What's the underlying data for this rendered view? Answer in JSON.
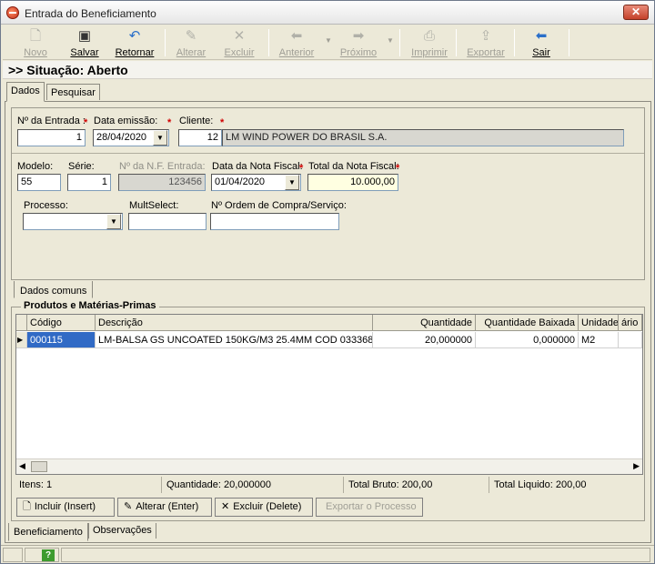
{
  "window": {
    "title": "Entrada do Beneficiamento"
  },
  "toolbar": {
    "novo": "Novo",
    "salvar": "Salvar",
    "retornar": "Retornar",
    "alterar": "Alterar",
    "excluir": "Excluir",
    "anterior": "Anterior",
    "proximo": "Próximo",
    "imprimir": "Imprimir",
    "exportar": "Exportar",
    "sair": "Sair"
  },
  "situation": ">> Situação: Aberto",
  "tabs": {
    "dados": "Dados",
    "pesquisar": "Pesquisar"
  },
  "form": {
    "n_entrada_label": "Nº da Entrada :",
    "n_entrada_value": "1",
    "data_emissao_label": "Data emissão:",
    "data_emissao_value": "28/04/2020",
    "cliente_label": "Cliente:",
    "cliente_code": "12",
    "cliente_name": "LM WIND POWER DO BRASIL S.A.",
    "modelo_label": "Modelo:",
    "modelo_value": "55",
    "serie_label": "Série:",
    "serie_value": "1",
    "nf_entrada_label": "Nº da N.F. Entrada:",
    "nf_entrada_value": "123456",
    "data_nf_label": "Data da Nota Fiscal:",
    "data_nf_value": "01/04/2020",
    "total_nf_label": "Total da Nota Fiscal:",
    "total_nf_value": "10.000,00",
    "processo_label": "Processo:",
    "processo_value": "",
    "multiselect_label": "MultSelect:",
    "multiselect_value": "",
    "ordem_label": "Nº Ordem de Compra/Serviço:",
    "ordem_value": ""
  },
  "subtab": {
    "dados_comuns": "Dados comuns"
  },
  "products": {
    "group_title": "Produtos e Matérias-Primas",
    "columns": [
      "Código",
      "Descrição",
      "Quantidade",
      "Quantidade Baixada",
      "Unidade",
      "ário"
    ],
    "rows": [
      {
        "codigo": "000115",
        "descricao": "LM-BALSA GS UNCOATED 150KG/M3 25.4MM COD 033368",
        "quantidade": "20,000000",
        "baixada": "0,000000",
        "unidade": "M2"
      }
    ]
  },
  "totals": {
    "itens": "Itens: 1",
    "quantidade": "Quantidade: 20,000000",
    "bruto": "Total Bruto: 200,00",
    "liquido": "Total Liquido: 200,00"
  },
  "actions": {
    "incluir": "Incluir (Insert)",
    "alterar": "Alterar (Enter)",
    "excluir": "Excluir (Delete)",
    "exportar": "Exportar o Processo"
  },
  "bottom_tabs": {
    "beneficiamento": "Beneficiamento",
    "observacoes": "Observações"
  },
  "icons": {
    "novo": "new-document-icon",
    "salvar": "floppy-disk-icon",
    "retornar": "undo-arrow-icon",
    "alterar": "edit-icon",
    "excluir": "x-delete-icon",
    "anterior": "left-arrow-icon",
    "proximo": "right-arrow-icon",
    "imprimir": "printer-icon",
    "exportar": "export-icon",
    "sair": "exit-arrow-icon"
  }
}
